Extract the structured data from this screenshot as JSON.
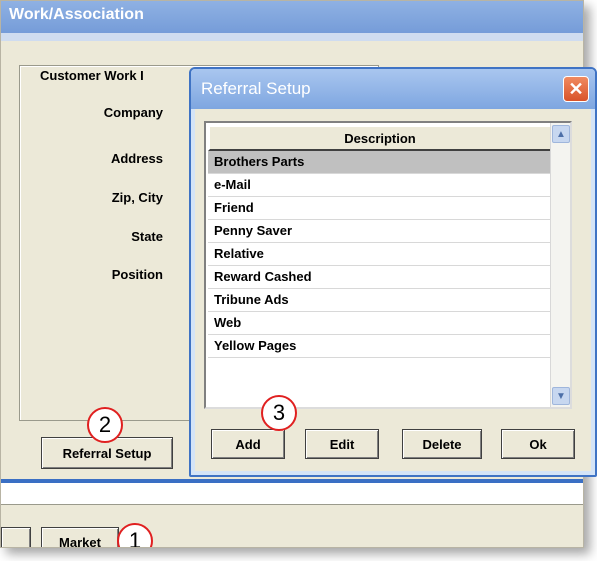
{
  "header": {
    "title": "Work/Association"
  },
  "customer_group": {
    "title": "Customer Work I",
    "labels": {
      "company": "Company",
      "address": "Address",
      "zip_city": "Zip, City",
      "state": "State",
      "position": "Position"
    }
  },
  "buttons": {
    "referral_setup": "Referral Setup",
    "market": "Market"
  },
  "callouts": {
    "one": "1",
    "two": "2",
    "three": "3"
  },
  "dialog": {
    "title": "Referral Setup",
    "close_glyph": "✕",
    "list_header": "Description",
    "selected_index": 0,
    "items": [
      "Brothers Parts",
      "e-Mail",
      "Friend",
      "Penny Saver",
      "Relative",
      "Reward Cashed",
      "Tribune Ads",
      "Web",
      "Yellow Pages"
    ],
    "buttons": {
      "add": "Add",
      "edit": "Edit",
      "delete": "Delete",
      "ok": "Ok"
    }
  },
  "icons": {
    "close": "close-icon",
    "scroll_up": "scroll-up-icon",
    "scroll_down": "scroll-down-icon"
  },
  "colors": {
    "callout_ring": "#e02020",
    "title_blue": "#3f73c4",
    "selection": "#c0c0c0"
  }
}
